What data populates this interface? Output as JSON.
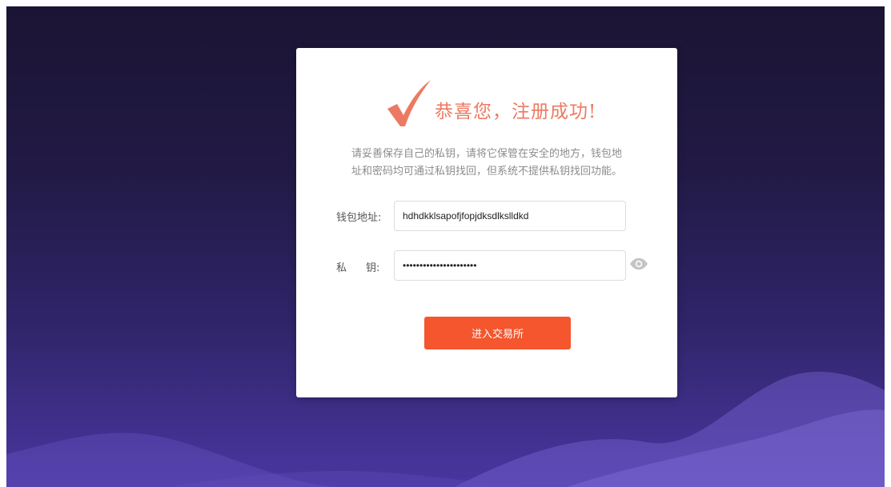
{
  "success": {
    "title": "恭喜您，注册成功!",
    "desc_line1": "请妥善保存自己的私钥，请将它保管在安全的地方，钱包地",
    "desc_line2": "址和密码均可通过私钥找回，但系统不提供私钥找回功能。"
  },
  "form": {
    "address_label": "钱包地址:",
    "address_value": "hdhdkklsapofjfopjdksdlkslldkd",
    "key_label_1": "私",
    "key_label_2": "钥:",
    "key_value": "••••••••••••••••••••••"
  },
  "actions": {
    "enter_label": "进入交易所"
  },
  "icons": {
    "success": "check-icon",
    "visibility": "eye-icon"
  },
  "colors": {
    "accent": "#ec7a63",
    "button": "#f5562d"
  }
}
